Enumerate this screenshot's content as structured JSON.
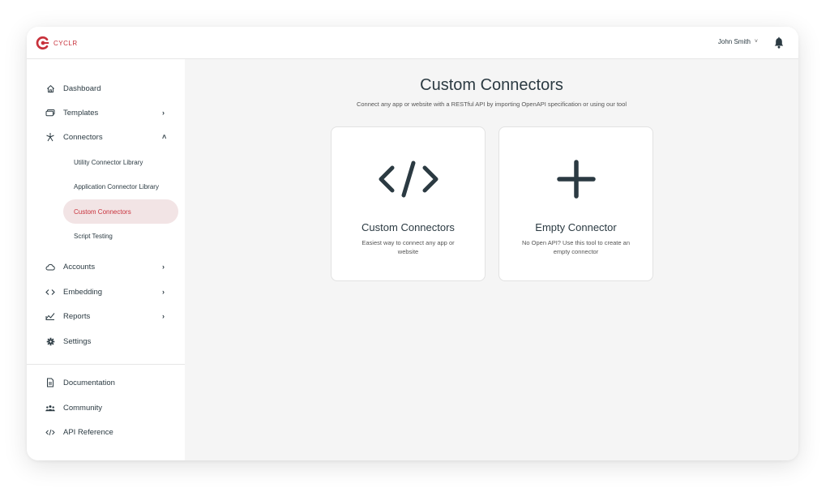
{
  "brand": {
    "name": "CYCLR",
    "color": "#c8323c"
  },
  "header": {
    "user_name": "John Smith",
    "user_chevron": "˅"
  },
  "sidebar": {
    "items": [
      {
        "label": "Dashboard",
        "icon": "home-icon"
      },
      {
        "label": "Templates",
        "icon": "templates-icon",
        "arrow": "›"
      },
      {
        "label": "Connectors",
        "icon": "connectors-icon",
        "arrow": "˄"
      },
      {
        "label": "Accounts",
        "icon": "cloud-icon",
        "arrow": "›"
      },
      {
        "label": "Embedding",
        "icon": "code-icon",
        "arrow": "›"
      },
      {
        "label": "Reports",
        "icon": "reports-icon",
        "arrow": "›"
      },
      {
        "label": "Settings",
        "icon": "gear-icon"
      }
    ],
    "sub_items": [
      {
        "label": "Utility Connector Library"
      },
      {
        "label": "Application Connector Library"
      },
      {
        "label": "Custom Connectors",
        "active": true
      },
      {
        "label": "Script Testing"
      }
    ],
    "footer_items": [
      {
        "label": "Documentation",
        "icon": "document-icon"
      },
      {
        "label": "Community",
        "icon": "community-icon"
      },
      {
        "label": "API Reference",
        "icon": "api-icon"
      }
    ]
  },
  "main": {
    "title": "Custom Connectors",
    "subtitle": "Connect any app or website with a RESTful API by importing OpenAPI specification or using our tool",
    "cards": [
      {
        "title": "Custom Connectors",
        "description": "Easiest way to connect any app or website",
        "icon": "code-brackets-icon"
      },
      {
        "title": "Empty Connector",
        "description": "No Open API? Use this tool to create an empty connector",
        "icon": "plus-icon"
      }
    ]
  }
}
